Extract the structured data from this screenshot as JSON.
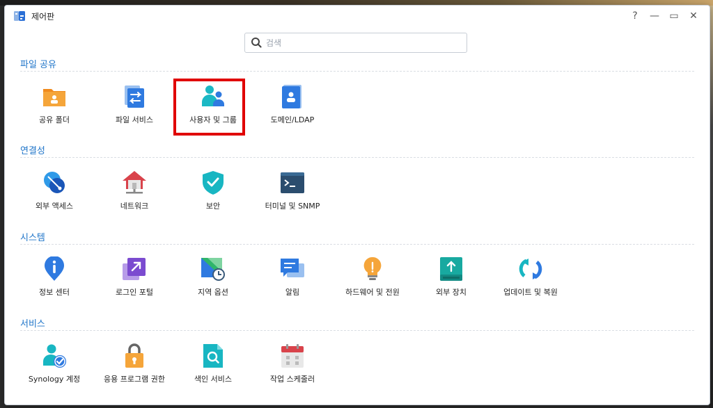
{
  "window": {
    "title": "제어판",
    "buttons": {
      "help": "?",
      "minimize": "—",
      "maximize": "▭",
      "close": "✕"
    }
  },
  "search": {
    "placeholder": "검색",
    "value": ""
  },
  "sections": [
    {
      "title": "파일 공유",
      "items": [
        {
          "label": "공유 폴더",
          "icon": "shared-folder-icon"
        },
        {
          "label": "파일 서비스",
          "icon": "file-services-icon"
        },
        {
          "label": "사용자 및 그룹",
          "icon": "user-group-icon",
          "highlighted": true
        },
        {
          "label": "도메인/LDAP",
          "icon": "domain-ldap-icon"
        }
      ]
    },
    {
      "title": "연결성",
      "items": [
        {
          "label": "외부 액세스",
          "icon": "external-access-icon"
        },
        {
          "label": "네트워크",
          "icon": "network-icon"
        },
        {
          "label": "보안",
          "icon": "security-shield-icon"
        },
        {
          "label": "터미널 및 SNMP",
          "icon": "terminal-icon"
        }
      ]
    },
    {
      "title": "시스템",
      "items": [
        {
          "label": "정보 센터",
          "icon": "info-center-icon"
        },
        {
          "label": "로그인 포털",
          "icon": "login-portal-icon"
        },
        {
          "label": "지역 옵션",
          "icon": "regional-options-icon"
        },
        {
          "label": "알림",
          "icon": "notification-icon"
        },
        {
          "label": "하드웨어 및 전원",
          "icon": "hardware-power-icon"
        },
        {
          "label": "외부 장치",
          "icon": "external-devices-icon"
        },
        {
          "label": "업데이트 및 복원",
          "icon": "update-restore-icon"
        }
      ]
    },
    {
      "title": "서비스",
      "items": [
        {
          "label": "Synology 계정",
          "icon": "synology-account-icon"
        },
        {
          "label": "응용 프로그램 권한",
          "icon": "app-privileges-icon"
        },
        {
          "label": "색인 서비스",
          "icon": "indexing-service-icon"
        },
        {
          "label": "작업 스케줄러",
          "icon": "task-scheduler-icon"
        }
      ]
    }
  ],
  "colors": {
    "accent": "#1f75c9",
    "highlight_box": "#e00000",
    "folder_orange": "#f5a53a",
    "shield_teal": "#18b6c2",
    "network_red": "#d9434b"
  }
}
